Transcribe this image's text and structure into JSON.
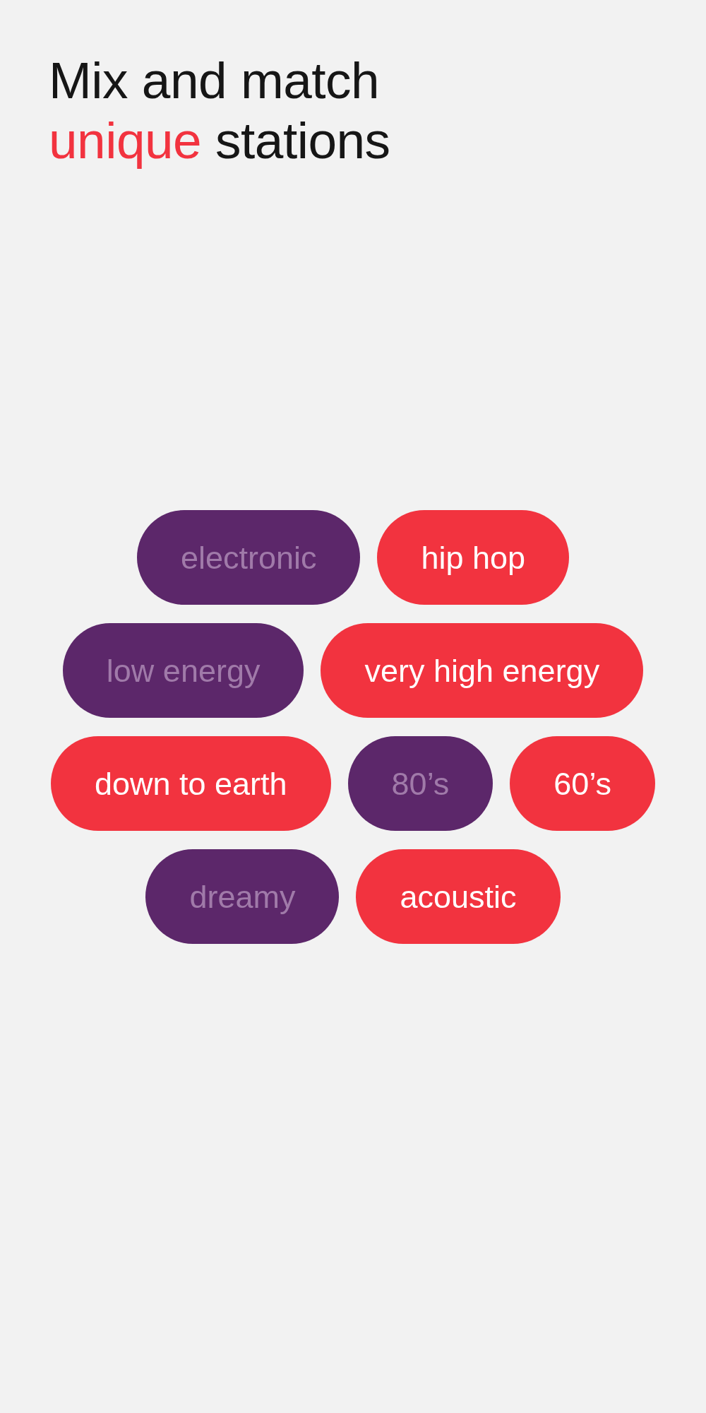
{
  "heading": [
    {
      "text": "Mix and match",
      "accent": false
    },
    {
      "text": "unique",
      "accent": true
    },
    {
      "text": "stations",
      "accent": false
    }
  ],
  "tag_rows": [
    {
      "tags": [
        {
          "label": "electronic",
          "selected": false
        },
        {
          "label": "hip hop",
          "selected": true
        }
      ]
    },
    {
      "tags": [
        {
          "label": "low energy",
          "selected": false
        },
        {
          "label": "very high energy",
          "selected": true
        }
      ]
    },
    {
      "tags": [
        {
          "label": "down to earth",
          "selected": true
        },
        {
          "label": "80’s",
          "selected": false
        },
        {
          "label": "60’s",
          "selected": true
        }
      ]
    },
    {
      "tags": [
        {
          "label": "dreamy",
          "selected": false
        },
        {
          "label": "acoustic",
          "selected": true
        }
      ]
    }
  ]
}
